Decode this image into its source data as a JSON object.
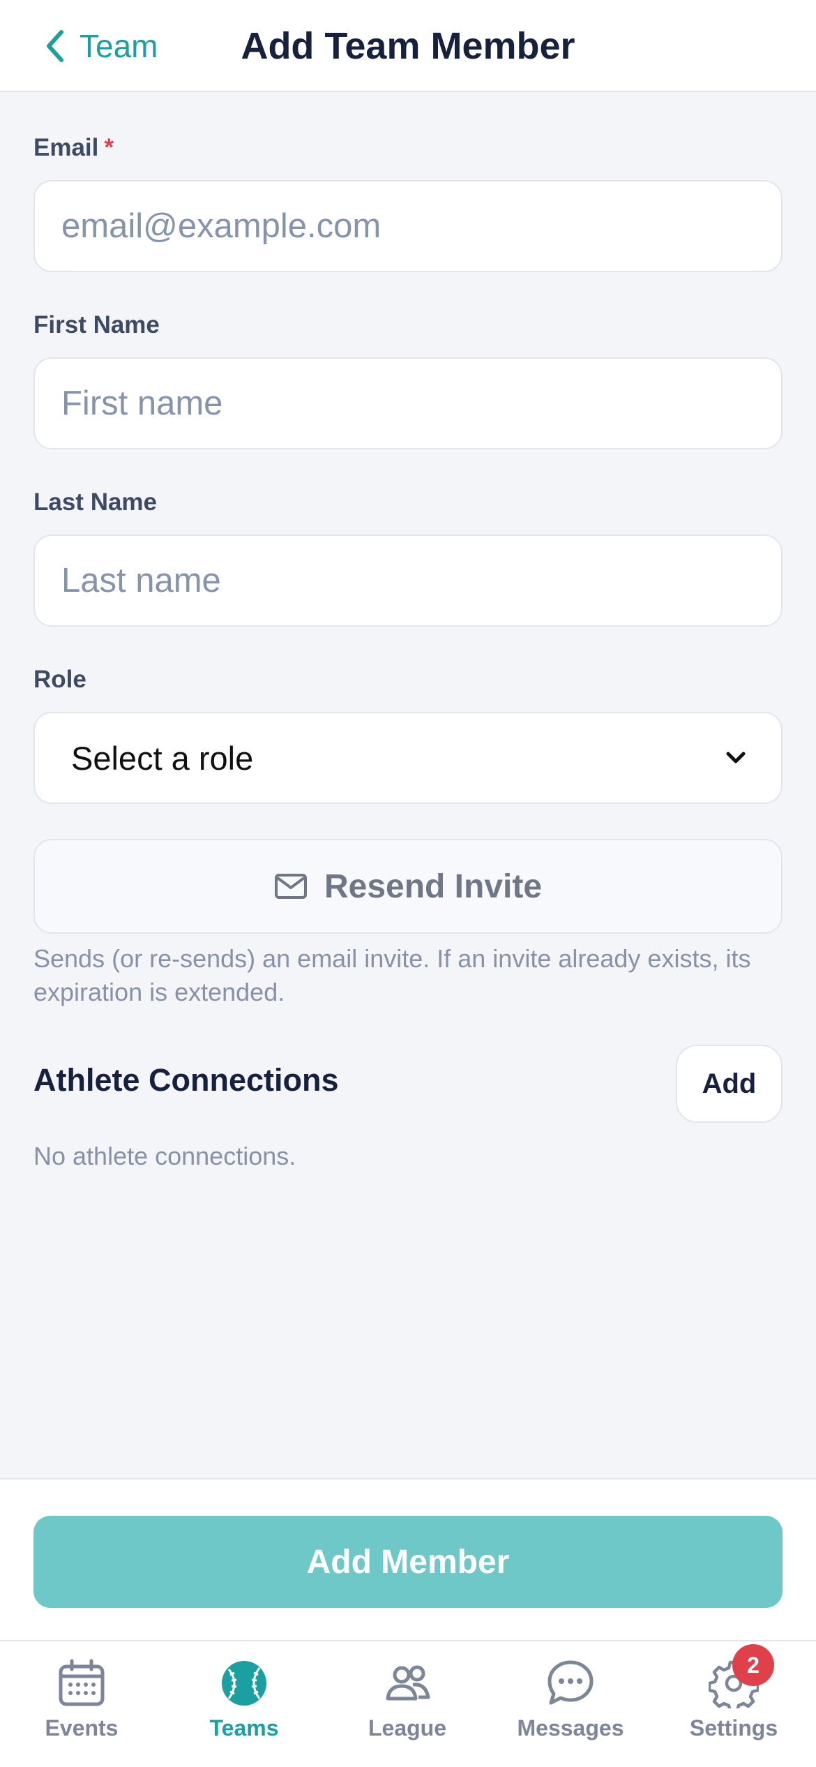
{
  "header": {
    "back_label": "Team",
    "title": "Add Team Member"
  },
  "form": {
    "email": {
      "label": "Email",
      "required_mark": "*",
      "placeholder": "email@example.com",
      "value": ""
    },
    "first_name": {
      "label": "First Name",
      "placeholder": "First name",
      "value": ""
    },
    "last_name": {
      "label": "Last Name",
      "placeholder": "Last name",
      "value": ""
    },
    "role": {
      "label": "Role",
      "selected": "Select a role"
    }
  },
  "invite": {
    "button_label": "Resend Invite",
    "helper_text": "Sends (or re-sends) an email invite. If an invite already exists, its expiration is extended."
  },
  "athletes": {
    "title": "Athlete Connections",
    "add_label": "Add",
    "empty_text": "No athlete connections."
  },
  "footer": {
    "primary_label": "Add Member"
  },
  "tabbar": {
    "items": [
      {
        "label": "Events",
        "icon": "calendar-icon",
        "active": false
      },
      {
        "label": "Teams",
        "icon": "baseball-icon",
        "active": true
      },
      {
        "label": "League",
        "icon": "people-icon",
        "active": false
      },
      {
        "label": "Messages",
        "icon": "chat-bubble-icon",
        "active": false
      },
      {
        "label": "Settings",
        "icon": "gear-icon",
        "active": false,
        "badge": "2"
      }
    ]
  },
  "colors": {
    "accent": "#1aa0a0",
    "primary_button": "#6fc8c8",
    "badge": "#e0404a",
    "title": "#15213d"
  }
}
